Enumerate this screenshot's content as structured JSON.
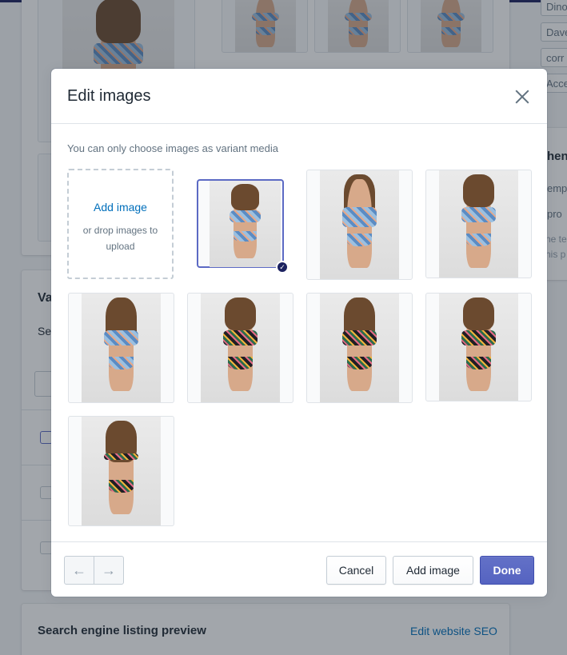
{
  "background": {
    "sidebar_chips": [
      "Dino",
      "Dave",
      "corr",
      "Acce"
    ],
    "section_partial_labels": [
      "Va",
      "Sel"
    ],
    "side_partial_labels": [
      "hen",
      "emp",
      "pro",
      "he te",
      "his p"
    ],
    "seo": {
      "title": "Search engine listing preview",
      "link": "Edit website SEO"
    }
  },
  "modal": {
    "title": "Edit images",
    "close_icon": "close-icon",
    "helper_text": "You can only choose images as variant media",
    "dropzone": {
      "link": "Add image",
      "hint": "or drop images to upload"
    },
    "images": [
      {
        "label": "image-1",
        "pattern": "blue",
        "selected": true
      },
      {
        "label": "image-2",
        "pattern": "blue",
        "selected": false
      },
      {
        "label": "image-3",
        "pattern": "blue",
        "selected": false
      },
      {
        "label": "image-4",
        "pattern": "blue",
        "selected": false
      },
      {
        "label": "image-5",
        "pattern": "dark",
        "selected": false
      },
      {
        "label": "image-6",
        "pattern": "dark",
        "selected": false
      },
      {
        "label": "image-7",
        "pattern": "dark",
        "selected": false
      },
      {
        "label": "image-8",
        "pattern": "dark",
        "selected": false
      }
    ],
    "footer": {
      "prev_icon": "arrow-left-icon",
      "next_icon": "arrow-right-icon",
      "prev_glyph": "←",
      "next_glyph": "→",
      "cancel": "Cancel",
      "add_image": "Add image",
      "done": "Done"
    }
  },
  "colors": {
    "primary": "#5c6ac4",
    "link": "#006fbb",
    "selected_badge": "#1c2260"
  }
}
